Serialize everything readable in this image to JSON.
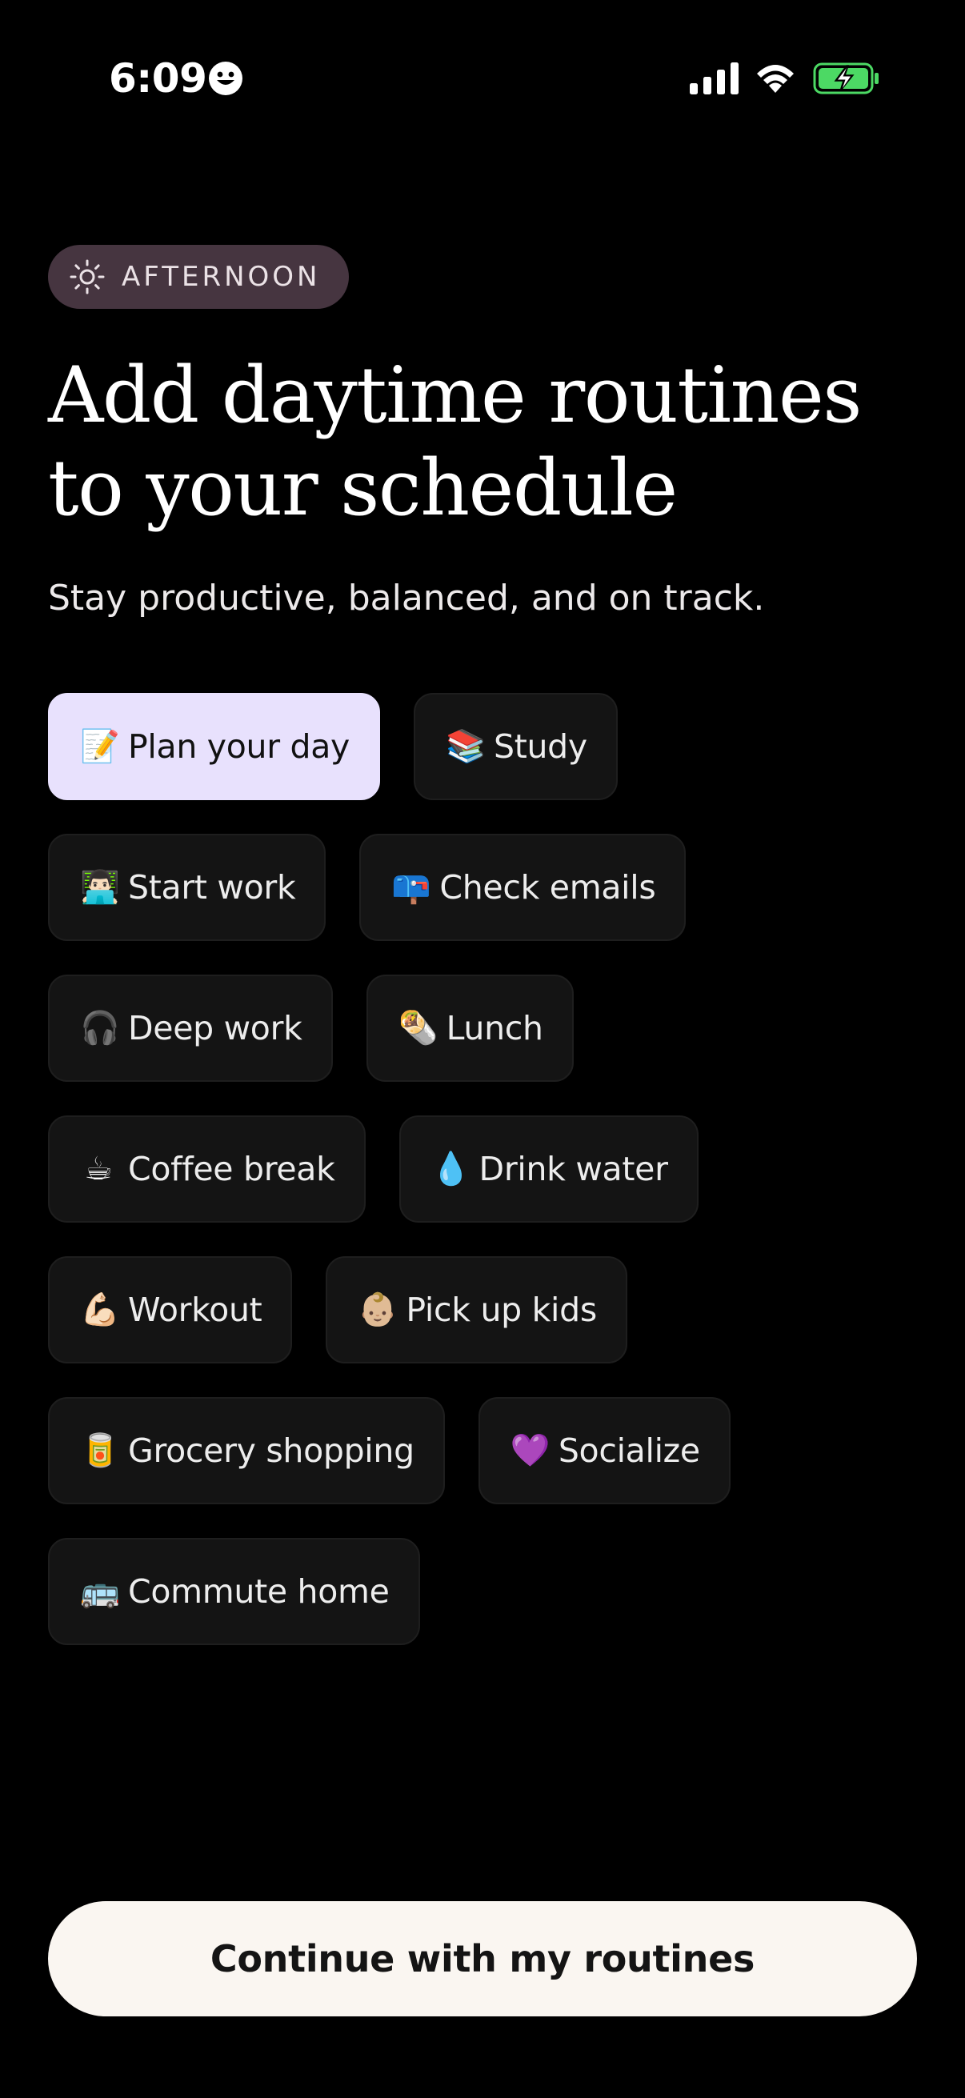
{
  "status_bar": {
    "time": "6:09",
    "icons": [
      "face-icon",
      "signal-icon",
      "wifi-icon",
      "battery-charging-icon"
    ],
    "battery_color": "#4cd964"
  },
  "pill": {
    "icon": "sun-icon",
    "label": "AFTERNOON",
    "color": "#463540"
  },
  "headline": "Add daytime routines to your schedule",
  "subtitle": "Stay productive, balanced, and on track.",
  "routines": [
    {
      "emoji": "📝",
      "icon": "memo-icon",
      "label": "Plan your day",
      "selected": true
    },
    {
      "emoji": "📚",
      "icon": "books-icon",
      "label": "Study",
      "selected": false
    },
    {
      "emoji": "👨🏻‍💻",
      "icon": "technologist-icon",
      "label": "Start work",
      "selected": false
    },
    {
      "emoji": "📪",
      "icon": "mailbox-icon",
      "label": "Check emails",
      "selected": false
    },
    {
      "emoji": "🎧",
      "icon": "headphones-icon",
      "label": "Deep work",
      "selected": false
    },
    {
      "emoji": "🌯",
      "icon": "burrito-icon",
      "label": "Lunch",
      "selected": false
    },
    {
      "emoji": "☕",
      "icon": "coffee-icon",
      "label": "Coffee break",
      "selected": false
    },
    {
      "emoji": "💧",
      "icon": "droplet-icon",
      "label": "Drink water",
      "selected": false
    },
    {
      "emoji": "💪🏻",
      "icon": "flexed-biceps-icon",
      "label": "Workout",
      "selected": false
    },
    {
      "emoji": "👶🏼",
      "icon": "baby-icon",
      "label": "Pick up kids",
      "selected": false
    },
    {
      "emoji": "🥫",
      "icon": "canned-food-icon",
      "label": "Grocery shopping",
      "selected": false
    },
    {
      "emoji": "💜",
      "icon": "purple-heart-icon",
      "label": "Socialize",
      "selected": false
    },
    {
      "emoji": "🚌",
      "icon": "bus-icon",
      "label": "Commute home",
      "selected": false
    }
  ],
  "colors": {
    "background": "#000000",
    "chip_background": "#141414",
    "chip_selected_background": "#e8e1fd",
    "button_background": "#faf6f1"
  },
  "continue_button": {
    "label": "Continue with my routines"
  }
}
